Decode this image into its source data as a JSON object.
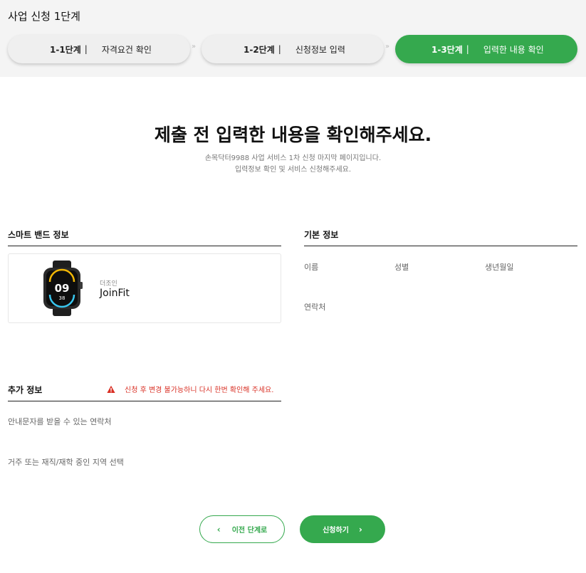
{
  "header": {
    "title": "사업 신청 1단계"
  },
  "steps": [
    {
      "num": "1-1단계",
      "label": "자격요건 확인"
    },
    {
      "num": "1-2단계",
      "label": "신청정보 입력"
    },
    {
      "num": "1-3단계",
      "label": "입력한 내용 확인"
    }
  ],
  "step_separator": "|",
  "step_arrow": "»",
  "intro": {
    "title": "제출 전 입력한 내용을 확인해주세요.",
    "line1": "손목닥터9988 사업 서비스 1차 신청 마지막 페이지입니다.",
    "line2": "입력정보 확인 및 서비스 신청해주세요."
  },
  "smart_band": {
    "title": "스마트 밴드 정보",
    "brand": "더조인",
    "model": "JoinFit",
    "watch_time": "09",
    "watch_sub": "38"
  },
  "basic_info": {
    "title": "기본 정보",
    "fields": {
      "name": "이름",
      "gender": "성별",
      "birth": "생년월일",
      "contact": "연락처"
    }
  },
  "extra_info": {
    "title": "추가 정보",
    "warning": "신청 후 변경 불가능하니 다시 한번 확인해 주세요.",
    "fields": {
      "notify_contact": "안내문자를 받을 수 있는 연락처",
      "region": "거주 또는 재직/재학 중인 지역 선택"
    }
  },
  "buttons": {
    "prev": "이전 단계로",
    "submit": "신청하기"
  },
  "colors": {
    "accent": "#35a94e",
    "warning": "#d93025",
    "topbar_bg": "#f4f4f4"
  }
}
